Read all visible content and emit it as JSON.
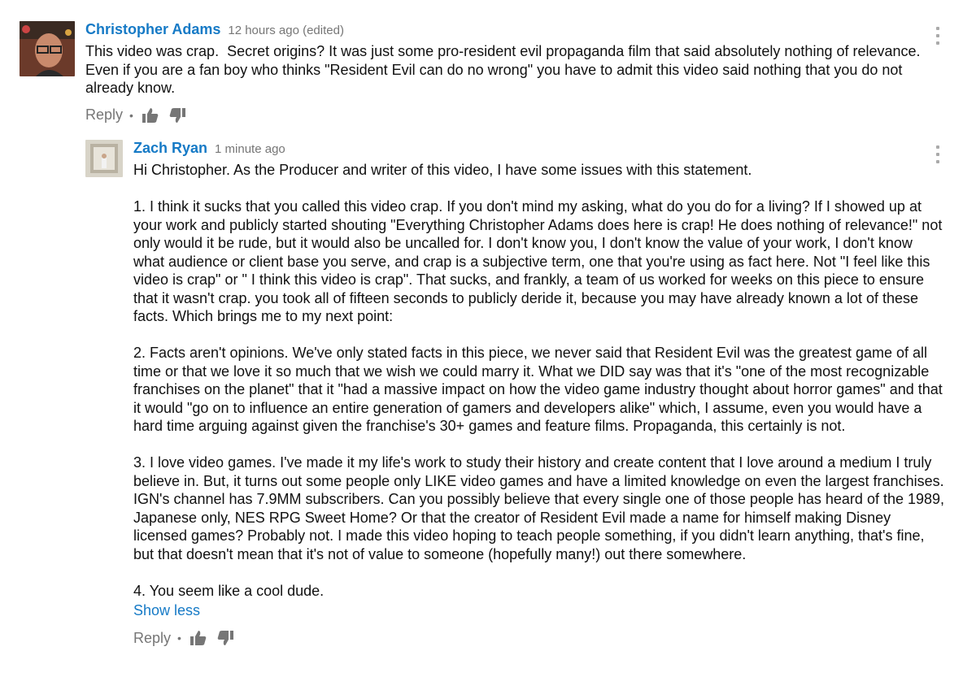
{
  "comments": [
    {
      "author": "Christopher Adams",
      "time": "12 hours ago (edited)",
      "text": "This video was crap.  Secret origins? It was just some pro-resident evil propaganda film that said absolutely nothing of relevance.  Even if you are a fan boy who thinks \"Resident Evil can do no wrong\" you have to admit this video said nothing that you do not already know.",
      "reply_label": "Reply",
      "separator": "•",
      "icons": {
        "like": "thumbs-up-icon",
        "dislike": "thumbs-down-icon",
        "menu": "kebab-menu-icon"
      }
    }
  ],
  "replies": [
    {
      "author": "Zach Ryan",
      "time": "1 minute ago",
      "text": "Hi Christopher. As the Producer and writer of this video, I have some issues with this statement.\n\n1. I think it sucks that you called this video crap. If you don't mind my asking, what do you do for a living? If I showed up at your work and publicly started shouting \"Everything Christopher Adams does here is crap! He does nothing of relevance!\" not only would it be rude, but it would also be uncalled for. I don't know you, I don't know the value of your work, I don't know what audience or client base you serve, and crap is a subjective term, one that you're using as fact here. Not \"I feel like this video is crap\" or \" I think this video is crap\". That sucks, and frankly, a team of us worked for weeks on this piece to ensure that it wasn't crap. you took all of fifteen seconds to publicly deride it, because you may have already known a lot of these facts. Which brings me to my next point:\n\n2. Facts aren't opinions. We've only stated facts in this piece, we never said that Resident Evil was the greatest game of all time or that we love it so much that we wish we could marry it. What we DID say was that it's \"one of the most recognizable franchises on the planet\" that it \"had a massive impact on how the video game industry thought about horror games\" and that it would \"go on to influence an entire generation of gamers and developers alike\" which, I assume, even you would have a hard time arguing against given the franchise's 30+ games and feature films. Propaganda, this certainly is not.\n\n3. I love video games. I've made it my life's work to study their history and create content that I love around a medium I truly believe in. But, it turns out some people only LIKE video games and have a limited knowledge on even the largest franchises. IGN's channel has 7.9MM subscribers. Can you possibly believe that every single one of those people has heard of the 1989, Japanese only, NES RPG Sweet Home? Or that the creator of Resident Evil made a name for himself making Disney licensed games? Probably not. I made this video hoping to teach people something, if you didn't learn anything, that's fine, but that doesn't mean that it's not of value to someone (hopefully many!) out there somewhere.\n\n4. You seem like a cool dude.",
      "show_less_label": "Show less",
      "reply_label": "Reply",
      "separator": "•",
      "icons": {
        "like": "thumbs-up-icon",
        "dislike": "thumbs-down-icon",
        "menu": "kebab-menu-icon"
      }
    }
  ],
  "colors": {
    "link": "#167ac6",
    "meta": "#767676",
    "text": "#111111",
    "icon": "#767676"
  }
}
